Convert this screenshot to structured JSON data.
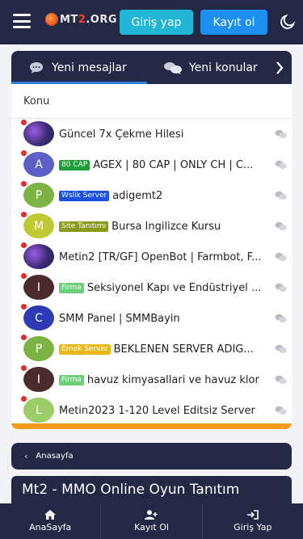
{
  "header": {
    "logo_prefix": "M",
    "logo_mid": "MT",
    "logo_accent": "2",
    "logo_suffix": ".ORG",
    "login_label": "Giriş yap",
    "register_label": "Kayıt ol"
  },
  "tabs": [
    {
      "label": "Yeni mesajlar",
      "icon": "chat-bubbles-icon"
    },
    {
      "label": "Yeni konular",
      "icon": "chat-bubbles-icon"
    }
  ],
  "list": {
    "column_header": "Konu",
    "rows": [
      {
        "avatar_letter": "",
        "avatar_color": "",
        "badge": "",
        "badge_color": "",
        "title": "Güncel 7x Çekme Hilesi"
      },
      {
        "avatar_letter": "A",
        "avatar_color": "#5b5fc7",
        "badge": "80 CAP",
        "badge_color": "#1e9e3a",
        "title": "AGEX | 80 CAP | ONLY CH | C..."
      },
      {
        "avatar_letter": "P",
        "avatar_color": "#7cb342",
        "badge": "Wslik Server",
        "badge_color": "#1a4fe0",
        "title": "adigemt2"
      },
      {
        "avatar_letter": "M",
        "avatar_color": "#c0ca33",
        "badge": "Site Tanıtımı",
        "badge_color": "#8a9a1a",
        "title": "Bursa İngilizce Kursu"
      },
      {
        "avatar_letter": "",
        "avatar_color": "",
        "badge": "",
        "badge_color": "",
        "title": "Metin2 [TR/GF] OpenBot | Farmbot, F..."
      },
      {
        "avatar_letter": "I",
        "avatar_color": "#4a2a2a",
        "badge": "Firma",
        "badge_color": "#6ccf7a",
        "title": "Seksiyonel Kapı ve Endüstriyel ..."
      },
      {
        "avatar_letter": "C",
        "avatar_color": "#2e3ab5",
        "badge": "",
        "badge_color": "",
        "title": "SMM Panel | SMMBayin"
      },
      {
        "avatar_letter": "P",
        "avatar_color": "#7cb342",
        "badge": "Emek Server",
        "badge_color": "#e9b81a",
        "title": "BEKLENEN SERVER ADİG..."
      },
      {
        "avatar_letter": "I",
        "avatar_color": "#4a2a2a",
        "badge": "Firma",
        "badge_color": "#6ccf7a",
        "title": "havuz kimyasallari ve havuz klor"
      },
      {
        "avatar_letter": "L",
        "avatar_color": "#9ccc65",
        "badge": "",
        "badge_color": "",
        "title": "Metin2023 1-120 Level Editsiz Server"
      }
    ]
  },
  "breadcrumb": {
    "label": "Anasayfa"
  },
  "page_title": "Mt2 - MMO Online Oyun Tanıtım",
  "bottom_nav": [
    {
      "label": "AnaSayfa",
      "icon": "home-icon"
    },
    {
      "label": "Kayıt Ol",
      "icon": "add-user-icon"
    },
    {
      "label": "Giriş Yap",
      "icon": "sign-in-icon"
    }
  ]
}
